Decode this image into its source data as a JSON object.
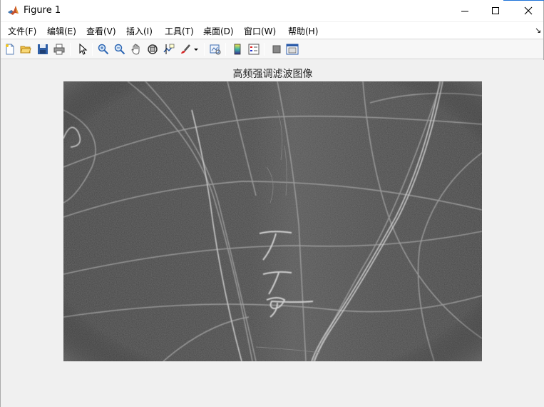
{
  "window": {
    "title": "Figure 1"
  },
  "menu": [
    {
      "label": "文件(F)"
    },
    {
      "label": "编辑(E)"
    },
    {
      "label": "查看(V)"
    },
    {
      "label": "插入(I)"
    },
    {
      "label": "工具(T)"
    },
    {
      "label": "桌面(D)"
    },
    {
      "label": "窗口(W)"
    },
    {
      "label": "帮助(H)"
    }
  ],
  "toolbar": {
    "buttons": [
      "new-figure-icon",
      "open-file-icon",
      "save-icon",
      "print-icon",
      "pointer-icon",
      "zoom-in-icon",
      "zoom-out-icon",
      "pan-hand-icon",
      "rotate-3d-icon",
      "data-cursor-icon",
      "brush-icon",
      "dropdown-arrow-icon",
      "link-plot-icon",
      "colorbar-icon",
      "legend-icon",
      "hide-plot-tools-icon",
      "show-plot-tools-icon"
    ]
  },
  "axes": {
    "title": "高频强调滤波图像"
  },
  "image": {
    "description_colors": {
      "background": "#4a4a4a",
      "strokes": "#b0b0b0",
      "border_glow": "#8a8a8a"
    }
  }
}
